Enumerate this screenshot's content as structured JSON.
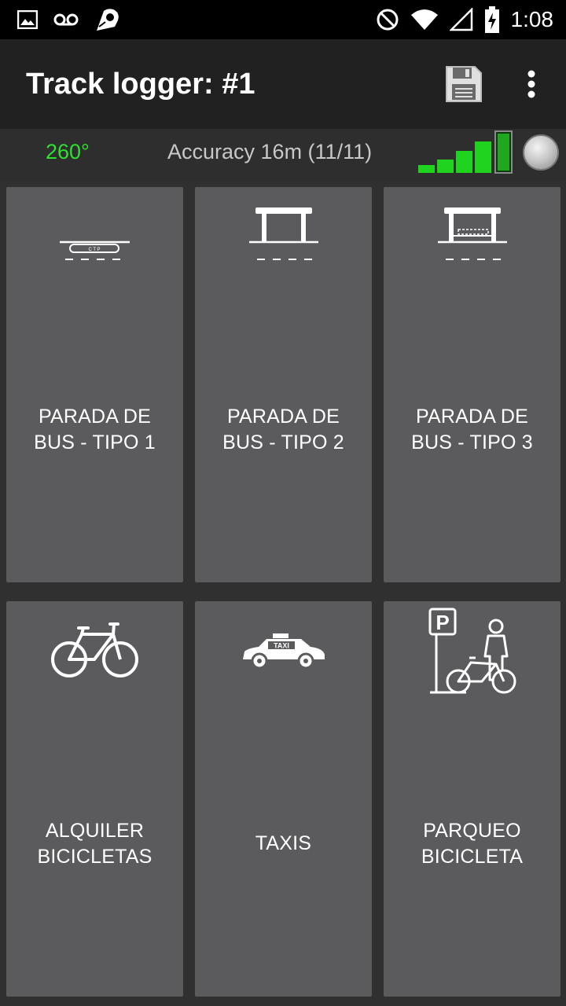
{
  "status_bar": {
    "time": "1:08",
    "icons": [
      "image-icon",
      "voicemail-icon",
      "app-notification-icon",
      "do-not-disturb-icon",
      "wifi-icon",
      "cell-signal-icon",
      "battery-charging-icon"
    ]
  },
  "app_bar": {
    "title": "Track logger: #1",
    "actions": [
      "save-icon",
      "more-vert-icon"
    ]
  },
  "info_bar": {
    "heading": "260°",
    "accuracy": "Accuracy 16m (11/11)",
    "signal_level": 0.8,
    "heading_color": "#2fe02f",
    "signal_color": "#1fd31f"
  },
  "tiles": [
    {
      "line1": "PARADA DE",
      "line2": "BUS - TIPO 1",
      "icon": "bus-stop-type1-icon"
    },
    {
      "line1": "PARADA DE",
      "line2": "BUS - TIPO 2",
      "icon": "bus-stop-type2-icon"
    },
    {
      "line1": "PARADA DE",
      "line2": "BUS - TIPO 3",
      "icon": "bus-stop-type3-icon"
    },
    {
      "line1": "ALQUILER",
      "line2": "BICICLETAS",
      "icon": "bicycle-icon"
    },
    {
      "line1": "TAXIS",
      "line2": "",
      "icon": "taxi-icon",
      "icon_text": "TAXI"
    },
    {
      "line1": "PARQUEO",
      "line2": "BICICLETA",
      "icon": "bicycle-parking-icon",
      "icon_text": "P"
    }
  ]
}
